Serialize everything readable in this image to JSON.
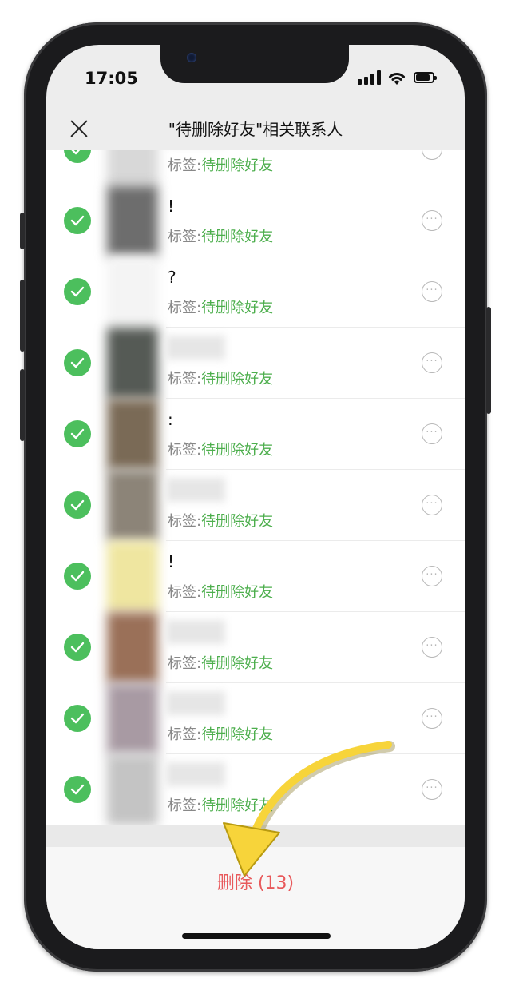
{
  "status": {
    "time": "17:05"
  },
  "nav": {
    "title": "\"待删除好友\"相关联系人"
  },
  "tag_prefix": "标签:",
  "tag_value": "待删除好友",
  "rows": [
    {
      "name": "",
      "avatar_color": "#d8d8d8"
    },
    {
      "name": "!",
      "avatar_color": "#6d6d6d"
    },
    {
      "name": "?",
      "avatar_color": "#f4f4f4"
    },
    {
      "name": "",
      "avatar_color": "#555a55"
    },
    {
      "name": ":",
      "avatar_color": "#7a6a56"
    },
    {
      "name": "",
      "avatar_color": "#8c8478"
    },
    {
      "name": "!",
      "avatar_color": "#efe6a0"
    },
    {
      "name": "",
      "avatar_color": "#9a7058"
    },
    {
      "name": "",
      "avatar_color": "#a89aa3"
    },
    {
      "name": "",
      "avatar_color": "#c4c4c4"
    }
  ],
  "footer": {
    "delete_label": "删除 (13)"
  },
  "colors": {
    "accent_green": "#4cbf5d",
    "delete_red": "#e8595b",
    "arrow_yellow": "#f7d43a"
  }
}
